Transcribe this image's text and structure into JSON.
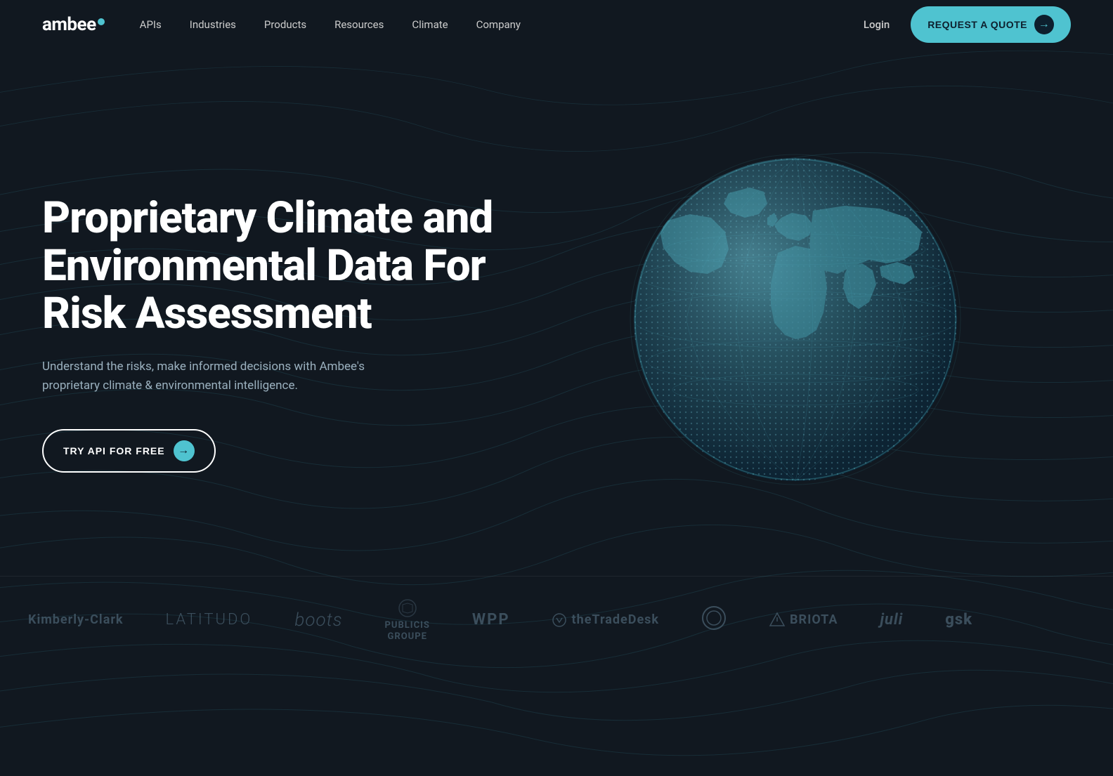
{
  "brand": {
    "name": "ambee",
    "dot_color": "#4fc3d0"
  },
  "nav": {
    "links": [
      {
        "label": "APIs",
        "id": "apis"
      },
      {
        "label": "Industries",
        "id": "industries"
      },
      {
        "label": "Products",
        "id": "products"
      },
      {
        "label": "Resources",
        "id": "resources"
      },
      {
        "label": "Climate",
        "id": "climate"
      },
      {
        "label": "Company",
        "id": "company"
      }
    ],
    "login_label": "Login",
    "cta_label": "REQUEST A QUOTE"
  },
  "hero": {
    "title": "Proprietary Climate and Environmental Data For Risk Assessment",
    "subtitle": "Understand the risks, make informed decisions with Ambee's proprietary climate & environmental intelligence.",
    "cta_label": "TRY API FOR FREE"
  },
  "logos": [
    {
      "label": "Kimberly-Clark",
      "class": "kimberly"
    },
    {
      "label": "LATITUDO",
      "class": "latitudo"
    },
    {
      "label": "boots",
      "class": "boots"
    },
    {
      "label": "PUBLICIS GROUPE",
      "class": "publicis"
    },
    {
      "label": "WPP",
      "class": "wpp"
    },
    {
      "label": "theTradeDesk",
      "class": "thetradedesk"
    },
    {
      "label": "BRIOTA",
      "class": "briota"
    },
    {
      "label": "juli",
      "class": "juli"
    },
    {
      "label": "gsk",
      "class": "gsk"
    }
  ],
  "colors": {
    "background": "#111820",
    "accent": "#4fc3d0",
    "text_primary": "#ffffff",
    "text_secondary": "#9ab0be",
    "logo_color": "#4a6070"
  }
}
